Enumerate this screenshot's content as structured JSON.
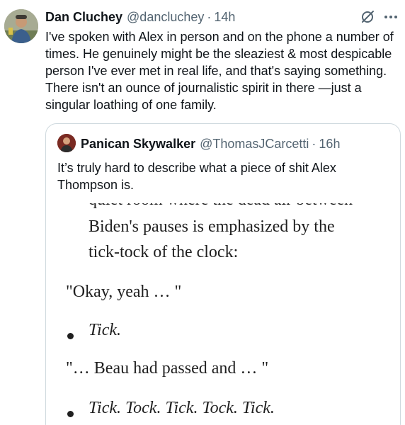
{
  "tweet": {
    "author_name": "Dan Cluchey",
    "handle": "@dancluchey",
    "separator": "·",
    "time": "14h",
    "text": "I've spoken with Alex in person and on the phone a number of times. He genuinely might be the sleaziest & most despicable person I've ever met in real life, and that's saying something. There isn't an ounce of journalistic spirit in there —just a singular loathing of one family."
  },
  "icons": {
    "grok": "grok-icon",
    "more": "more-icon"
  },
  "quote": {
    "author_name": "Panican Skywalker",
    "handle": "@ThomasJCarcetti",
    "separator": "·",
    "time": "16h",
    "text": "It’s truly hard to describe what a piece of shit Alex Thompson is.",
    "image_text": {
      "cut_line": "quiet room where the dead air between",
      "line1": "Biden's pauses is emphasized by the",
      "line2": "tick-tock of the clock:",
      "line3": "\"Okay, yeah … \"",
      "line4": "Tick.",
      "line5": "\"… Beau had passed and … \"",
      "line6": "Tick. Tock. Tick. Tock. Tick."
    }
  },
  "colors": {
    "text": "#0f1419",
    "secondary": "#536471",
    "border": "#cfd9de"
  }
}
